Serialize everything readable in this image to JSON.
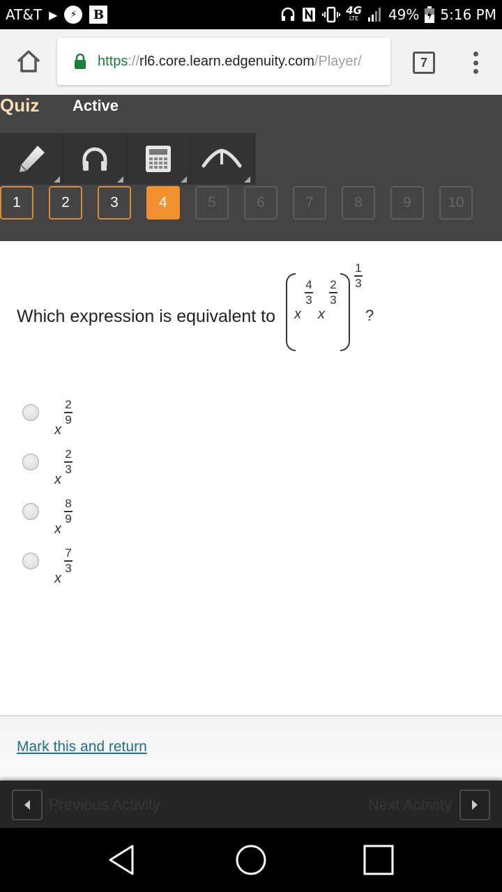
{
  "status_bar": {
    "carrier": "AT&T",
    "left_icons": [
      "play-icon",
      "messenger-icon",
      "b-app-icon"
    ],
    "right_icons": [
      "headset-icon",
      "nfc-icon",
      "vibrate-icon",
      "4g-lte-icon",
      "signal-icon",
      "battery-icon"
    ],
    "network": "4G",
    "network_sub": "LTE",
    "battery": "49%",
    "time": "5:16 PM"
  },
  "browser": {
    "url_scheme": "https",
    "url_sep": "://",
    "url_host": "rl6.core.learn.edgenuity.com",
    "url_path": "/Player/",
    "tab_count": "7"
  },
  "quiz": {
    "type_label": "Quiz",
    "status_label": "Active",
    "tools": [
      {
        "name": "pencil",
        "icon": "pencil-icon"
      },
      {
        "name": "audio",
        "icon": "headphones-icon"
      },
      {
        "name": "calculator",
        "icon": "calculator-icon"
      },
      {
        "name": "translate",
        "icon": "caret-up-icon"
      }
    ],
    "questions": [
      {
        "label": "1",
        "state": "done"
      },
      {
        "label": "2",
        "state": "done"
      },
      {
        "label": "3",
        "state": "done"
      },
      {
        "label": "4",
        "state": "current"
      },
      {
        "label": "5",
        "state": "todo"
      },
      {
        "label": "6",
        "state": "todo"
      },
      {
        "label": "7",
        "state": "todo"
      },
      {
        "label": "8",
        "state": "todo"
      },
      {
        "label": "9",
        "state": "todo"
      },
      {
        "label": "10",
        "state": "todo"
      }
    ],
    "colors": {
      "accent": "#f39130",
      "done_border": "#d98a3a",
      "header_bg": "#444444"
    }
  },
  "question": {
    "prompt": "Which expression is equivalent to",
    "expression": {
      "base": "x",
      "term1_num": "4",
      "term1_den": "3",
      "term2_num": "2",
      "term2_den": "3",
      "outer_num": "1",
      "outer_den": "3"
    },
    "end": "?",
    "options": [
      {
        "base": "x",
        "num": "2",
        "den": "9"
      },
      {
        "base": "x",
        "num": "2",
        "den": "3"
      },
      {
        "base": "x",
        "num": "8",
        "den": "9"
      },
      {
        "base": "x",
        "num": "7",
        "den": "3"
      }
    ]
  },
  "footer": {
    "mark_link": "Mark this and return",
    "prev_label": "Previous Activity",
    "next_label": "Next Activity"
  }
}
